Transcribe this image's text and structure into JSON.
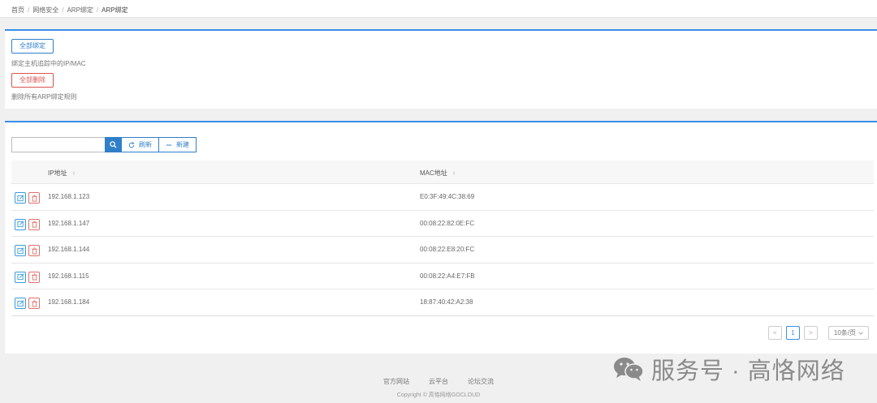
{
  "breadcrumb": {
    "items": [
      "首页",
      "网络安全",
      "ARP绑定",
      "ARP绑定"
    ],
    "separator": "/"
  },
  "bind_panel": {
    "bind_all_label": "全部绑定",
    "bind_all_hint": "绑定主机追踪中的IP/MAC",
    "delete_all_label": "全部删除",
    "delete_all_hint": "删除所有ARP绑定规则"
  },
  "toolbar": {
    "search_placeholder": "",
    "search_value": "",
    "refresh_label": "刷新",
    "new_label": "新建"
  },
  "table": {
    "columns": [
      "IP地址",
      "MAC地址"
    ],
    "rows": [
      {
        "ip": "192.168.1.123",
        "mac": "E0:3F:49:4C:38:69"
      },
      {
        "ip": "192.168.1.147",
        "mac": "00:08:22:82:0E:FC"
      },
      {
        "ip": "192.168.1.144",
        "mac": "00:08:22:E8:20:FC"
      },
      {
        "ip": "192.168.1.115",
        "mac": "00:08:22:A4:E7:FB"
      },
      {
        "ip": "192.168.1.184",
        "mac": "18:87:40:42:A2:38"
      }
    ]
  },
  "pagination": {
    "prev": "<",
    "current_page": "1",
    "next": ">",
    "page_size": "10条/页"
  },
  "footer": {
    "links": [
      "官方网站",
      "云平台",
      "论坛交流"
    ],
    "copyright": "Copyright © 高恪网络GOCLOUD"
  },
  "watermark": {
    "text": "服务号 · 高恪网络"
  },
  "colors": {
    "primary": "#2f7fc9",
    "danger": "#d9534f",
    "panel_accent": "#3a8ee6"
  }
}
